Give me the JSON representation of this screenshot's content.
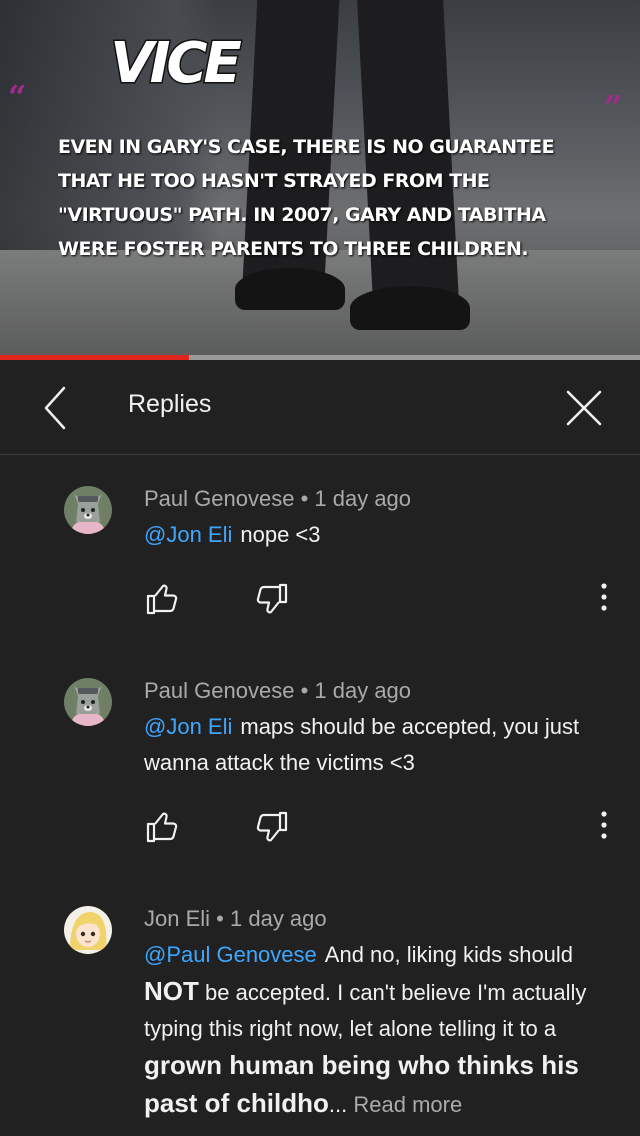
{
  "video": {
    "logo": "VICE",
    "caption": "Even in Gary's case, there is no guarantee that he too hasn't strayed from the \"virtuous\" path. In 2007, Gary and Tabitha were foster parents to three children.",
    "quote_open": "“",
    "quote_close": "”",
    "progress": 0.295,
    "accent_color": "#e0261c"
  },
  "header": {
    "title": "Replies",
    "back_icon": "chevron-left-icon",
    "close_icon": "close-icon"
  },
  "comments": [
    {
      "author": "Paul Genovese",
      "time": "1 day ago",
      "mention": "@Jon Eli",
      "text": "nope <3"
    },
    {
      "author": "Paul Genovese",
      "time": "1 day ago",
      "mention": "@Jon Eli",
      "text": "maps should be accepted, you just wanna attack the victims <3"
    },
    {
      "author": "Jon Eli",
      "time": "1 day ago",
      "mention": "@Paul Genovese",
      "text_1": "And no, liking kids should ",
      "text_bold": "NOT",
      "text_2": " be accepted. I can't believe I'm actually typing this right now, let alone telling it to a ",
      "text_strong": "grown human being who thinks his past of childho",
      "ellipsis": "...",
      "read_more": "Read more"
    }
  ],
  "colors": {
    "background": "#212121",
    "mention": "#3ea6ff",
    "meta": "#aaaaaa",
    "text": "#f1f1f1"
  }
}
